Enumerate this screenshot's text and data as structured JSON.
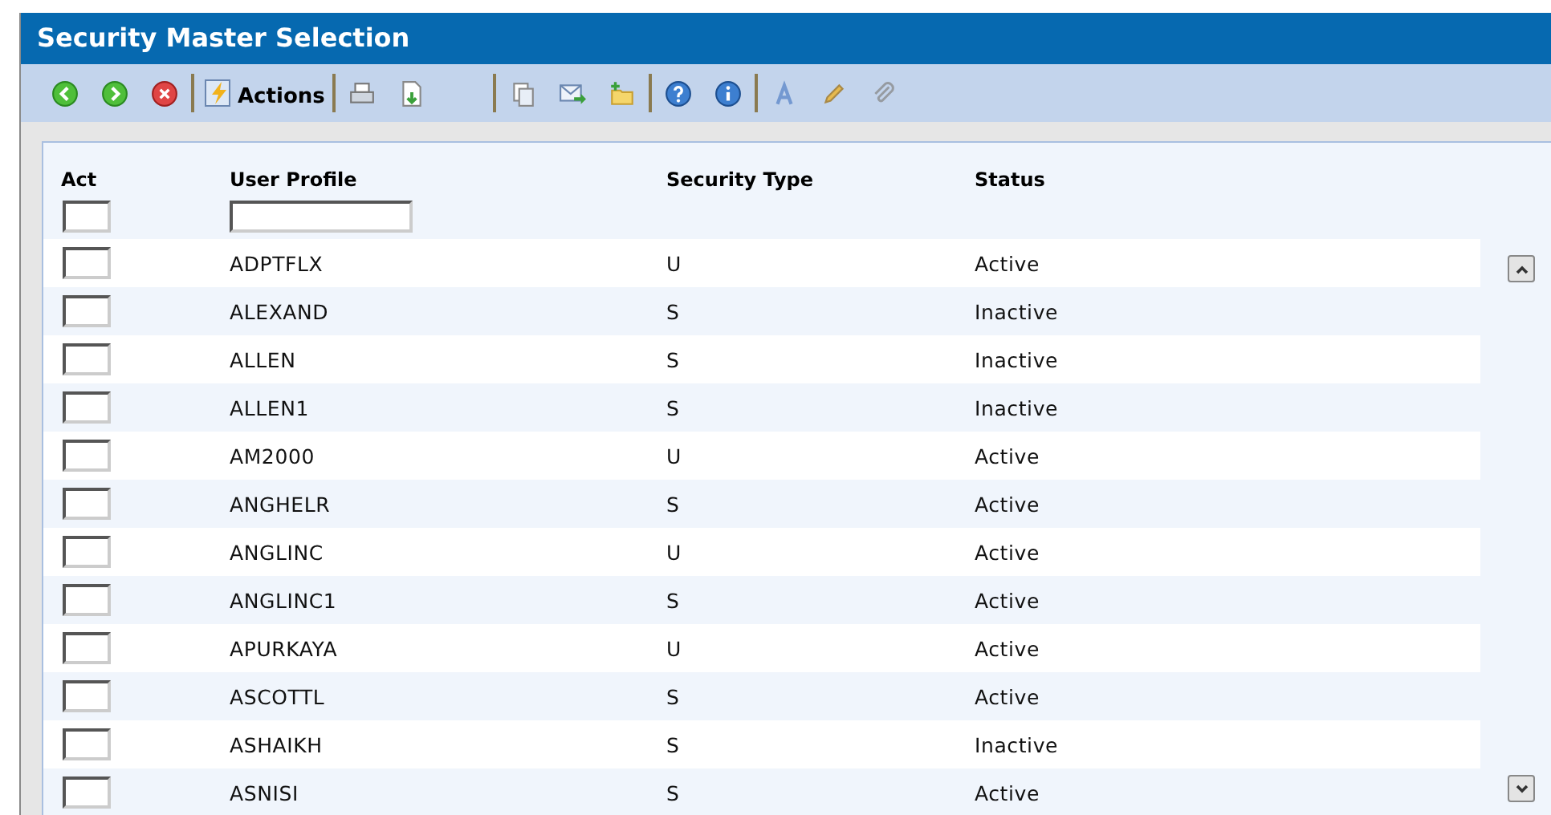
{
  "window": {
    "title": "Security Master Selection"
  },
  "toolbar": {
    "actions_label": "Actions"
  },
  "table": {
    "columns": [
      "Act",
      "User Profile",
      "Security Type",
      "Status"
    ],
    "filter": {
      "act_checked": false
    },
    "rows": [
      {
        "checked": false,
        "user_profile": "ADPTFLX",
        "security_type": "U",
        "status": "Active"
      },
      {
        "checked": false,
        "user_profile": "ALEXAND",
        "security_type": "S",
        "status": "Inactive"
      },
      {
        "checked": false,
        "user_profile": "ALLEN",
        "security_type": "S",
        "status": "Inactive"
      },
      {
        "checked": false,
        "user_profile": "ALLEN1",
        "security_type": "S",
        "status": "Inactive"
      },
      {
        "checked": false,
        "user_profile": "AM2000",
        "security_type": "U",
        "status": "Active"
      },
      {
        "checked": false,
        "user_profile": "ANGHELR",
        "security_type": "S",
        "status": "Active"
      },
      {
        "checked": false,
        "user_profile": "ANGLINC",
        "security_type": "U",
        "status": "Active"
      },
      {
        "checked": false,
        "user_profile": "ANGLINC1",
        "security_type": "S",
        "status": "Active"
      },
      {
        "checked": false,
        "user_profile": "APURKAYA",
        "security_type": "U",
        "status": "Active"
      },
      {
        "checked": false,
        "user_profile": "ASCOTTL",
        "security_type": "S",
        "status": "Active"
      },
      {
        "checked": false,
        "user_profile": "ASHAIKH",
        "security_type": "S",
        "status": "Inactive"
      },
      {
        "checked": false,
        "user_profile": "ASNISI",
        "security_type": "S",
        "status": "Active"
      }
    ]
  }
}
